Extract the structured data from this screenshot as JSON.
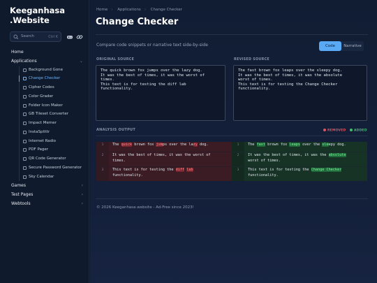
{
  "brand": {
    "line1": "Keeganhasa",
    "line2": ".Website"
  },
  "search": {
    "label": "Search",
    "shortcut": "Ctrl K"
  },
  "nav": {
    "home": "Home",
    "applications": "Applications",
    "apps": [
      "Background Gone",
      "Change Checker",
      "Cipher Codes",
      "Color Grader",
      "Folder Icon Maker",
      "GB Tileset Converter",
      "Impact Memer",
      "InstaSplittr",
      "Internet Radio",
      "PDF Pager",
      "QR Code Generator",
      "Secure Password Generator",
      "Sky Calendar"
    ],
    "games": "Games",
    "test_pages": "Test Pages",
    "webtools": "Webtools"
  },
  "breadcrumb": [
    "Home",
    "Applications",
    "Change Checker"
  ],
  "page": {
    "title": "Change Checker",
    "subtitle": "Compare code snippets or narrative text side-by-side",
    "mode_code": "Code",
    "mode_narrative": "Narrative"
  },
  "original": {
    "label": "ORIGINAL SOURCE",
    "text": "The quick brown fox jumps over the lazy dog.\nIt was the best of times, it was the worst of\ntimes.\nThis text is for testing the diff lab\nfunctionality."
  },
  "revised": {
    "label": "REVISED SOURCE",
    "text": "The fast brown fox leaps over the sleepy dog.\nIt was the best of times, it was the absolute\nworst of times.\nThis text is for testing the Change Checker\nfunctionality."
  },
  "analysis": {
    "label": "ANALYSIS OUTPUT",
    "removed": "REMOVED",
    "added": "ADDED",
    "line_numbers": [
      "1",
      "2",
      "3"
    ]
  },
  "diff_left": {
    "r1": [
      "The ",
      "quick",
      " brown fox ",
      "jum",
      "ps over the la",
      "zy",
      " dog."
    ],
    "r2": [
      "It was the best of times, it was the worst of",
      "times."
    ],
    "r3": [
      "This text is for testing the ",
      "diff",
      " ",
      "lab",
      "functionality."
    ]
  },
  "diff_right": {
    "r1": [
      "The ",
      "fast",
      " brown fox ",
      "leaps",
      " over the ",
      "sle",
      "epy dog."
    ],
    "r2": [
      "It was the best of times, it was the ",
      "absolute",
      "worst of times."
    ],
    "r3": [
      "This text is for testing the ",
      "Change Checker",
      "functionality."
    ]
  },
  "footer": "© 2026 Keeganhasa.website - Ad-Free since 2023!",
  "colors": {
    "accent": "#5aa9f5",
    "removed": "#e05561",
    "added": "#3fbf6a"
  }
}
